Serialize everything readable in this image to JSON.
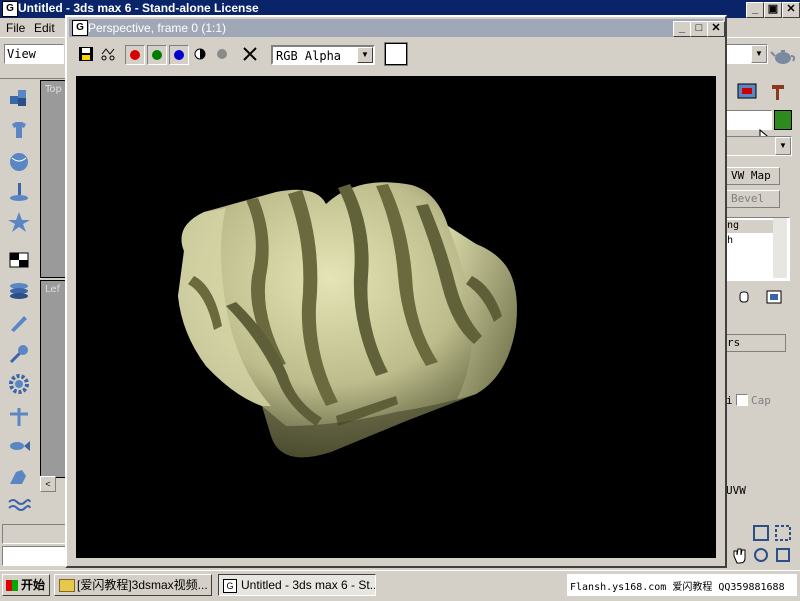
{
  "main_window": {
    "title": "Untitled - 3ds max 6 - Stand-alone License",
    "menu": [
      "File",
      "Edit"
    ],
    "view_dropdown": "View",
    "viewports": [
      {
        "label": "Top"
      },
      {
        "label": "Lef"
      }
    ]
  },
  "render_window": {
    "title": "Perspective, frame 0 (1:1)",
    "channel_value": "RGB Alpha",
    "channel_colors": {
      "red": "#d40000",
      "green": "#007d00",
      "blue": "#0000cc"
    }
  },
  "command_panel": {
    "uvw_map_label": "VW Map",
    "bevel_label": "Bevel",
    "list_items": [
      "ng",
      "h"
    ],
    "rollout_label": "rs",
    "cap_label": "Cap",
    "partial_label": "i",
    "uvw_label": "UVW",
    "color_swatch": "#2e8a1e"
  },
  "taskbar": {
    "start_label": "开始",
    "tasks": [
      {
        "label": "[爱闪教程]3dsmax视频..."
      },
      {
        "label": "Untitled - 3ds max 6 - St..."
      }
    ],
    "tray_text": "Flansh.ys168.com 爱闪教程 QQ359881688"
  }
}
